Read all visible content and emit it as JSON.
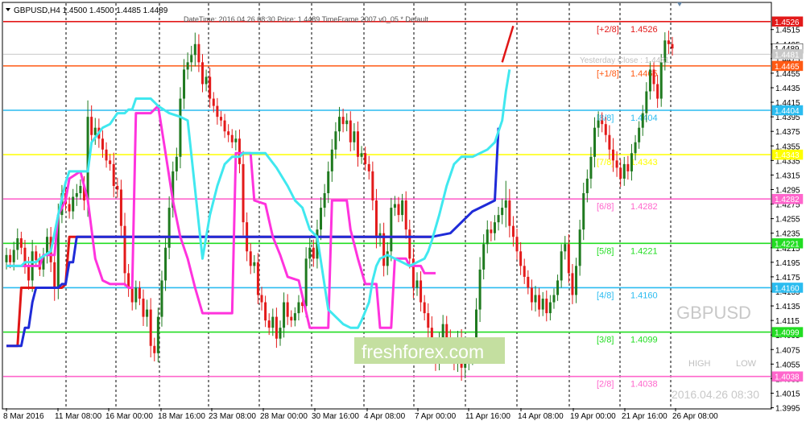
{
  "header": {
    "symbol_line": "GBPUSD,H4  1.4500 1.4500 1.4485 1.4489",
    "info_line": "DateTime: 2016.04.26 08:30   Price: 1.4489   TimeFrame 2007 v0_05   *  Default"
  },
  "overlay": {
    "symbol": "GBPUSD",
    "watermark": "freshforex.com",
    "high_label": "HIGH",
    "low_label": "LOW",
    "timestamp": "2016.04.26 08:30",
    "yesterday_close_label": "Yesterday Close : 1.4481"
  },
  "colors": {
    "up_candle": "#1f7a1f",
    "down_candle": "#e31a1a",
    "magenta_line": "#ff33dd",
    "cyan_line": "#40e8ef",
    "blue_line": "#1f2bd8",
    "red_line": "#e01616"
  },
  "chart_data": {
    "type": "candlestick",
    "symbol": "GBPUSD",
    "timeframe": "H4",
    "ylim": [
      1.39945,
      1.45512
    ],
    "y_ticks": [
      "1.4515",
      "1.4495",
      "1.4475",
      "1.4455",
      "1.4435",
      "1.4415",
      "1.4395",
      "1.4375",
      "1.4355",
      "1.4335",
      "1.4315",
      "1.4295",
      "1.4275",
      "1.4255",
      "1.4235",
      "1.4215",
      "1.4195",
      "1.4175",
      "1.4155",
      "1.4135",
      "1.4115",
      "1.4095",
      "1.4075",
      "1.4055",
      "1.4035",
      "1.4015",
      "1.3995"
    ],
    "x_ticks": [
      "8 Mar 2016",
      "11 Mar 08:00",
      "16 Mar 00:00",
      "18 Mar 16:00",
      "23 Mar 08:00",
      "28 Mar 00:00",
      "30 Mar 16:00",
      "4 Apr 08:00",
      "7 Apr 00:00",
      "11 Apr 16:00",
      "14 Apr 08:00",
      "19 Apr 00:00",
      "21 Apr 16:00",
      "26 Apr 08:00"
    ],
    "murrey_levels": [
      {
        "label": "[+2/8]",
        "value": 1.4526,
        "color": "#e31a1a"
      },
      {
        "label": "[+1/8]",
        "value": 1.4465,
        "color": "#ff5a14"
      },
      {
        "label": "[8/8]",
        "value": 1.4404,
        "color": "#2bbcf0"
      },
      {
        "label": "[7/8]",
        "value": 1.4343,
        "color": "#ffff00"
      },
      {
        "label": "[6/8]",
        "value": 1.4282,
        "color": "#ff66cc"
      },
      {
        "label": "[5/8]",
        "value": 1.4221,
        "color": "#22dd22"
      },
      {
        "label": "[4/8]",
        "value": 1.416,
        "color": "#2bbcf0"
      },
      {
        "label": "[3/8]",
        "value": 1.4099,
        "color": "#22dd22"
      },
      {
        "label": "[2/8]",
        "value": 1.4038,
        "color": "#ff66cc"
      }
    ],
    "price_boxes": [
      {
        "value": "1.4526",
        "bg": "#e31a1a",
        "fg": "#ffffff"
      },
      {
        "value": "1.4489",
        "bg": "#ffffff",
        "fg": "#000000"
      },
      {
        "value": "1.4481",
        "bg": "#c8c8c8",
        "fg": "#ffffff"
      },
      {
        "value": "1.4465",
        "bg": "#ff5a14",
        "fg": "#ffffff"
      },
      {
        "value": "1.4404",
        "bg": "#2bbcf0",
        "fg": "#ffffff"
      },
      {
        "value": "1.4343",
        "bg": "#ffff00",
        "fg": "#ffffff"
      },
      {
        "value": "1.4282",
        "bg": "#ff66cc",
        "fg": "#ffffff"
      },
      {
        "value": "1.4221",
        "bg": "#22dd22",
        "fg": "#ffffff"
      },
      {
        "value": "1.4160",
        "bg": "#2bbcf0",
        "fg": "#ffffff"
      },
      {
        "value": "1.4099",
        "bg": "#22dd22",
        "fg": "#ffffff"
      },
      {
        "value": "1.4038",
        "bg": "#ff66cc",
        "fg": "#ffffff"
      }
    ],
    "close_series": [
      1.4205,
      1.4195,
      1.4212,
      1.4228,
      1.4215,
      1.419,
      1.417,
      1.421,
      1.4198,
      1.4185,
      1.4205,
      1.423,
      1.4195,
      1.416,
      1.426,
      1.429,
      1.4275,
      1.4265,
      1.4285,
      1.429,
      1.43,
      1.428,
      1.4395,
      1.437,
      1.438,
      1.4365,
      1.435,
      1.4335,
      1.433,
      1.43,
      1.4295,
      1.4245,
      1.418,
      1.416,
      1.414,
      1.416,
      1.4145,
      1.412,
      1.413,
      1.408,
      1.407,
      1.412,
      1.417,
      1.4215,
      1.427,
      1.432,
      1.434,
      1.442,
      1.446,
      1.447,
      1.448,
      1.4495,
      1.447,
      1.444,
      1.445,
      1.442,
      1.441,
      1.4395,
      1.439,
      1.4375,
      1.437,
      1.436,
      1.4365,
      1.433,
      1.425,
      1.421,
      1.419,
      1.4195,
      1.415,
      1.414,
      1.4115,
      1.4105,
      1.412,
      1.409,
      1.4105,
      1.414,
      1.412,
      1.4115,
      1.4125,
      1.414,
      1.4135,
      1.42,
      1.4215,
      1.42,
      1.424,
      1.427,
      1.429,
      1.432,
      1.435,
      1.4375,
      1.4395,
      1.4385,
      1.439,
      1.436,
      1.4375,
      1.434,
      1.4345,
      1.433,
      1.432,
      1.428,
      1.423,
      1.4235,
      1.419,
      1.421,
      1.427,
      1.4275,
      1.426,
      1.428,
      1.424,
      1.42,
      1.416,
      1.417,
      1.414,
      1.4125,
      1.4105,
      1.4075,
      1.406,
      1.4085,
      1.411,
      1.409,
      1.407,
      1.406,
      1.4085,
      1.405,
      1.406,
      1.4065,
      1.408,
      1.413,
      1.4185,
      1.422,
      1.424,
      1.4235,
      1.425,
      1.426,
      1.427,
      1.428,
      1.4245,
      1.423,
      1.421,
      1.419,
      1.4175,
      1.416,
      1.414,
      1.415,
      1.413,
      1.4145,
      1.4125,
      1.414,
      1.415,
      1.417,
      1.421,
      1.422,
      1.418,
      1.415,
      1.419,
      1.424,
      1.429,
      1.431,
      1.434,
      1.438,
      1.439,
      1.4385,
      1.437,
      1.435,
      1.4335,
      1.4325,
      1.431,
      1.433,
      1.432,
      1.4345,
      1.436,
      1.438,
      1.44,
      1.443,
      1.446,
      1.444,
      1.442,
      1.447,
      1.45,
      1.4495,
      1.4489
    ],
    "bar_range": [
      0.0022,
      0.0018,
      0.0025,
      0.003,
      0.002,
      0.0024,
      0.0028,
      0.0035,
      0.0018,
      0.002,
      0.0022,
      0.0026,
      0.003,
      0.004,
      0.0035,
      0.0025,
      0.002,
      0.0022,
      0.0024,
      0.0028,
      0.002,
      0.003,
      0.005,
      0.0035,
      0.003,
      0.0028,
      0.0025,
      0.0022,
      0.002,
      0.0035,
      0.0025,
      0.003,
      0.004,
      0.0028,
      0.0025,
      0.0022,
      0.002,
      0.0028,
      0.003,
      0.0035,
      0.0025,
      0.0028,
      0.003,
      0.0032,
      0.0035,
      0.003,
      0.0028,
      0.0035,
      0.0032,
      0.003,
      0.0028,
      0.0035,
      0.003,
      0.0025,
      0.0022,
      0.0028,
      0.002,
      0.0024,
      0.0018,
      0.002,
      0.0022,
      0.0018,
      0.0025,
      0.0028,
      0.004,
      0.003,
      0.0025,
      0.0022,
      0.0028,
      0.0025,
      0.002,
      0.0022,
      0.0025,
      0.0028,
      0.0022,
      0.003,
      0.0025,
      0.002,
      0.0018,
      0.0022,
      0.002,
      0.0035,
      0.003,
      0.0025,
      0.003,
      0.0032,
      0.0028,
      0.003,
      0.0032,
      0.0028,
      0.003,
      0.0025,
      0.0022,
      0.0028,
      0.0025,
      0.003,
      0.0022,
      0.002,
      0.0025,
      0.003,
      0.0035,
      0.003,
      0.0032,
      0.0028,
      0.003,
      0.0025,
      0.0022,
      0.002,
      0.0028,
      0.003,
      0.0032,
      0.0025,
      0.0028,
      0.0022,
      0.003,
      0.0035,
      0.0032,
      0.003,
      0.0028,
      0.0025,
      0.0028,
      0.003,
      0.0035,
      0.004,
      0.0032,
      0.003,
      0.0025,
      0.0035,
      0.0038,
      0.003,
      0.0028,
      0.0025,
      0.0022,
      0.0025,
      0.0028,
      0.006,
      0.0035,
      0.003,
      0.0025,
      0.0028,
      0.0022,
      0.002,
      0.0025,
      0.0028,
      0.0022,
      0.002,
      0.0025,
      0.0022,
      0.002,
      0.0018,
      0.0022,
      0.0025,
      0.003,
      0.0028,
      0.0025,
      0.003,
      0.0032,
      0.0028,
      0.003,
      0.0032,
      0.0028,
      0.0025,
      0.0022,
      0.003,
      0.0035,
      0.0028,
      0.0025,
      0.0022,
      0.0025,
      0.0028,
      0.0022,
      0.002,
      0.0025,
      0.0028,
      0.0025,
      0.0022,
      0.0028,
      0.0025,
      0.0025,
      0.003,
      0.0022,
      0.0015
    ],
    "magenta_line": [
      [
        0,
        1.419
      ],
      [
        9,
        1.419
      ],
      [
        10,
        1.4205
      ],
      [
        13,
        1.4205
      ],
      [
        14,
        1.426
      ],
      [
        16,
        1.428
      ],
      [
        17,
        1.431
      ],
      [
        20,
        1.432
      ],
      [
        22,
        1.428
      ],
      [
        24,
        1.42
      ],
      [
        26,
        1.417
      ],
      [
        28,
        1.4165
      ],
      [
        29,
        1.4165
      ],
      [
        32,
        1.4165
      ],
      [
        33,
        1.416
      ],
      [
        34,
        1.416
      ],
      [
        35,
        1.44
      ],
      [
        39,
        1.44
      ],
      [
        41,
        1.441
      ],
      [
        43,
        1.4345
      ],
      [
        45,
        1.428
      ],
      [
        47,
        1.423
      ],
      [
        49,
        1.42
      ],
      [
        51,
        1.416
      ],
      [
        53,
        1.4125
      ],
      [
        61,
        1.4125
      ],
      [
        62,
        1.4345
      ],
      [
        66,
        1.4345
      ],
      [
        67,
        1.428
      ],
      [
        70,
        1.4275
      ],
      [
        72,
        1.423
      ],
      [
        74,
        1.4205
      ],
      [
        76,
        1.4175
      ],
      [
        79,
        1.417
      ],
      [
        82,
        1.4105
      ],
      [
        87,
        1.4105
      ],
      [
        88,
        1.428
      ],
      [
        92,
        1.428
      ],
      [
        93,
        1.424
      ],
      [
        95,
        1.42
      ],
      [
        97,
        1.4165
      ],
      [
        100,
        1.4165
      ],
      [
        101,
        1.4105
      ],
      [
        104,
        1.4105
      ],
      [
        105,
        1.42
      ],
      [
        108,
        1.42
      ],
      [
        109,
        1.419
      ],
      [
        112,
        1.419
      ],
      [
        113,
        1.418
      ],
      [
        116,
        1.418
      ]
    ],
    "cyan_line": [
      [
        0,
        1.419
      ],
      [
        4,
        1.419
      ],
      [
        5,
        1.4195
      ],
      [
        8,
        1.4195
      ],
      [
        9,
        1.42
      ],
      [
        12,
        1.421
      ],
      [
        14,
        1.426
      ],
      [
        16,
        1.4305
      ],
      [
        17,
        1.432
      ],
      [
        22,
        1.432
      ],
      [
        23,
        1.436
      ],
      [
        26,
        1.438
      ],
      [
        28,
        1.4385
      ],
      [
        30,
        1.44
      ],
      [
        32,
        1.44
      ],
      [
        33,
        1.4405
      ],
      [
        34,
        1.4405
      ],
      [
        35,
        1.442
      ],
      [
        39,
        1.442
      ],
      [
        41,
        1.441
      ],
      [
        44,
        1.44
      ],
      [
        47,
        1.4395
      ],
      [
        49,
        1.439
      ],
      [
        53,
        1.42
      ],
      [
        55,
        1.426
      ],
      [
        57,
        1.43
      ],
      [
        59,
        1.433
      ],
      [
        61,
        1.434
      ],
      [
        63,
        1.434
      ],
      [
        64,
        1.4345
      ],
      [
        70,
        1.4345
      ],
      [
        73,
        1.4325
      ],
      [
        76,
        1.43
      ],
      [
        78,
        1.428
      ],
      [
        80,
        1.427
      ],
      [
        82,
        1.424
      ],
      [
        84,
        1.423
      ],
      [
        87,
        1.413
      ],
      [
        89,
        1.412
      ],
      [
        91,
        1.411
      ],
      [
        93,
        1.4105
      ],
      [
        95,
        1.4105
      ],
      [
        96,
        1.4115
      ],
      [
        98,
        1.414
      ],
      [
        99,
        1.417
      ],
      [
        100,
        1.419
      ],
      [
        101,
        1.42
      ],
      [
        103,
        1.4205
      ],
      [
        105,
        1.42
      ],
      [
        107,
        1.4195
      ],
      [
        109,
        1.419
      ],
      [
        111,
        1.4195
      ],
      [
        113,
        1.42
      ],
      [
        114,
        1.421
      ],
      [
        115,
        1.4225
      ],
      [
        117,
        1.426
      ],
      [
        119,
        1.43
      ],
      [
        121,
        1.433
      ],
      [
        123,
        1.434
      ],
      [
        126,
        1.434
      ],
      [
        128,
        1.4345
      ],
      [
        130,
        1.435
      ],
      [
        132,
        1.436
      ],
      [
        134,
        1.439
      ],
      [
        135,
        1.443
      ],
      [
        136,
        1.446
      ]
    ],
    "blue_line": [
      [
        0,
        1.408
      ],
      [
        4,
        1.408
      ],
      [
        5,
        1.4105
      ],
      [
        6,
        1.4105
      ],
      [
        7,
        1.414
      ],
      [
        8,
        1.416
      ],
      [
        9,
        1.416
      ],
      [
        14,
        1.416
      ],
      [
        15,
        1.4165
      ],
      [
        16,
        1.4165
      ],
      [
        17,
        1.4195
      ],
      [
        18,
        1.4195
      ],
      [
        19,
        1.423
      ],
      [
        30,
        1.423
      ],
      [
        40,
        1.423
      ],
      [
        60,
        1.423
      ],
      [
        80,
        1.423
      ],
      [
        110,
        1.423
      ],
      [
        115,
        1.423
      ],
      [
        120,
        1.4235
      ],
      [
        126,
        1.4265
      ],
      [
        130,
        1.4275
      ],
      [
        132,
        1.428
      ],
      [
        133,
        1.438
      ]
    ],
    "red_line": [
      [
        0,
        1.408
      ],
      [
        3,
        1.408
      ],
      [
        4,
        1.416
      ],
      [
        15,
        1.416
      ],
      [
        16,
        1.4165
      ],
      [
        17,
        1.423
      ],
      [
        60,
        1.423
      ],
      [
        80,
        1.423
      ],
      [
        110,
        1.423
      ],
      [
        115,
        1.423
      ]
    ],
    "forecast_line": [
      [
        134,
        1.447
      ],
      [
        137,
        1.452
      ]
    ]
  }
}
